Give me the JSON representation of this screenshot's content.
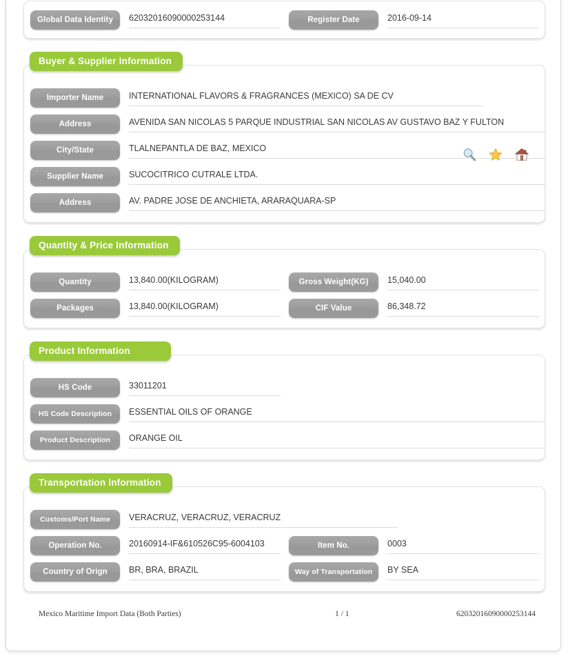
{
  "header": {
    "fields": [
      {
        "label": "Global Data Identity",
        "value": "62032016090000253144"
      },
      {
        "label": "Register Date",
        "value": "2016-09-14"
      }
    ]
  },
  "sections": [
    {
      "title": "Buyer & Supplier Information",
      "rows": [
        {
          "label": "Importer Name",
          "value": "INTERNATIONAL FLAVORS & FRAGRANCES (MEXICO) SA DE CV"
        },
        {
          "label": "Address",
          "value": "AVENIDA SAN NICOLAS 5 PARQUE INDUSTRIAL SAN NICOLAS AV GUSTAVO BAZ Y FULTON"
        },
        {
          "label": "City/State",
          "value": "TLALNEPANTLA DE BAZ, MEXICO"
        },
        {
          "label": "Supplier Name",
          "value": "SUCOCITRICO CUTRALE LTDA."
        },
        {
          "label": "Address",
          "value": "AV. PADRE JOSE DE ANCHIETA, ARARAQUARA-SP"
        }
      ],
      "actions": [
        {
          "name": "search-icon",
          "title": "Search"
        },
        {
          "name": "favorite-icon",
          "title": "Favorite"
        },
        {
          "name": "home-icon",
          "title": "Home"
        }
      ]
    },
    {
      "title": "Quantity & Price Information",
      "pairs": [
        {
          "left": {
            "label": "Quantity",
            "value": "13,840.00(KILOGRAM)"
          },
          "right": {
            "label": "Gross Weight(KG)",
            "value": "15,040.00"
          }
        },
        {
          "left": {
            "label": "Packages",
            "value": "13,840.00(KILOGRAM)"
          },
          "right": {
            "label": "CIF Value",
            "value": "86,348.72"
          }
        }
      ]
    },
    {
      "title": "Product Information",
      "rows": [
        {
          "label": "HS Code",
          "value": "33011201"
        },
        {
          "label": "HS Code Description",
          "value": "ESSENTIAL OILS OF ORANGE"
        },
        {
          "label": "Product Description",
          "value": "ORANGE OIL"
        }
      ]
    },
    {
      "title": "Transportation Information",
      "customs": {
        "label": "Customs/Port Name",
        "value": "VERACRUZ, VERACRUZ, VERACRUZ"
      },
      "pairs": [
        {
          "left": {
            "label": "Operation No.",
            "value": "20160914-IF&610526C95-6004103"
          },
          "right": {
            "label": "Item No.",
            "value": "0003"
          }
        },
        {
          "left": {
            "label": "Country of Orign",
            "value": "BR, BRA, BRAZIL"
          },
          "right": {
            "label": "Way of Transportation",
            "value": "BY SEA"
          }
        }
      ]
    }
  ],
  "footer": {
    "source": "Mexico Maritime Import Data (Both Parties)",
    "page": "1 / 1",
    "identity": "62032016090000253144"
  },
  "theme": {
    "accent_green": "#9ac93a",
    "label_gray": "#9d9d9d",
    "text": "#3a3a3a",
    "underline": "#dcdcdc"
  }
}
